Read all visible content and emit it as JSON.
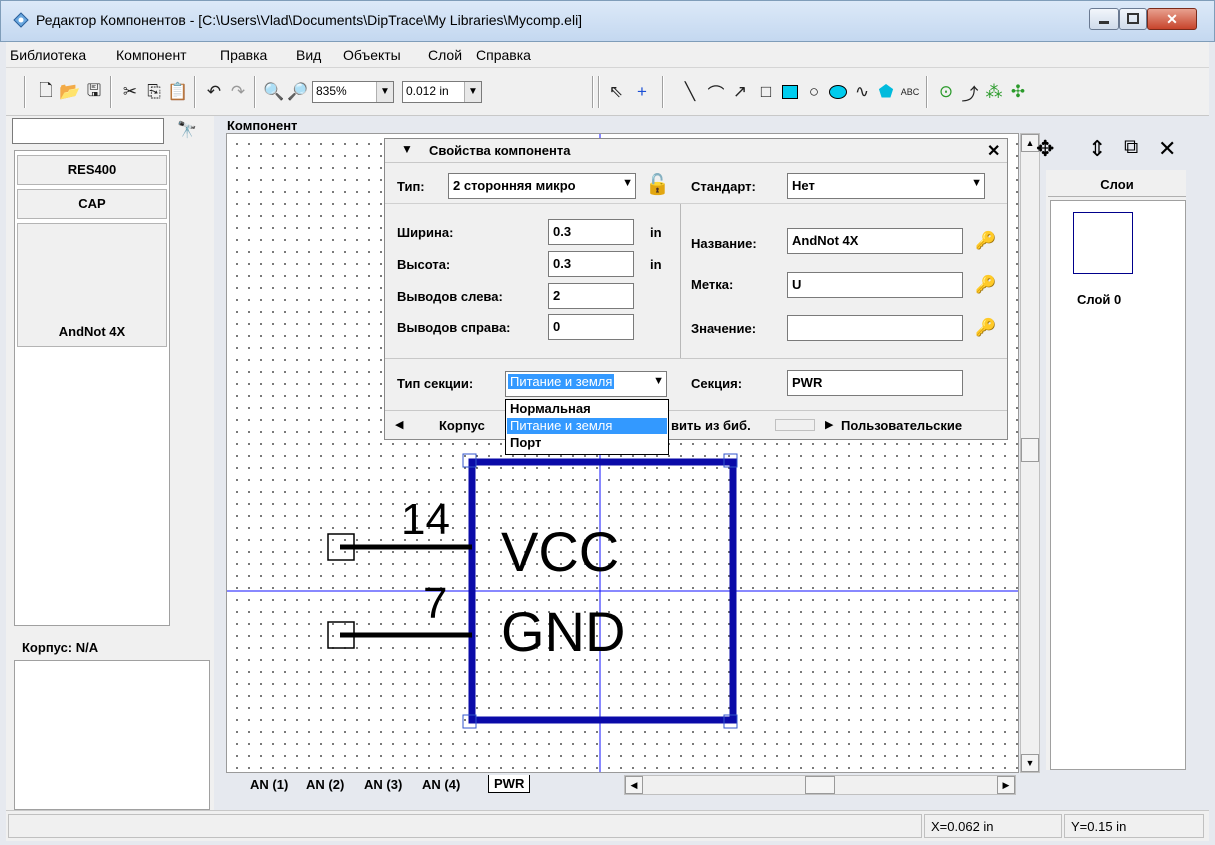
{
  "window": {
    "title": "Редактор Компонентов - [C:\\Users\\Vlad\\Documents\\DipTrace\\My Libraries\\Mycomp.eli]",
    "close_label": "✕"
  },
  "menu": [
    "Библиотека",
    "Компонент",
    "Правка",
    "Вид",
    "Объекты",
    "Слой",
    "Справка"
  ],
  "toolbar": {
    "zoom_value": "835%",
    "grid_value": "0.012 in"
  },
  "left_panel": {
    "components": [
      "RES400",
      "CAP",
      "AndNot 4X"
    ],
    "package_label": "Корпус: N/A"
  },
  "canvas": {
    "label": "Компонент",
    "pins": [
      {
        "number": "14",
        "name": "VCC"
      },
      {
        "number": "7",
        "name": "GND"
      }
    ],
    "tabs": [
      "AN (1)",
      "AN (2)",
      "AN (3)",
      "AN (4)",
      "PWR"
    ],
    "active_tab": "PWR"
  },
  "dialog": {
    "title": "Свойства компонента",
    "type_label": "Тип:",
    "type_value": "2 сторонняя микро",
    "standard_label": "Стандарт:",
    "standard_value": "Нет",
    "width_label": "Ширина:",
    "width_value": "0.3",
    "width_unit": "in",
    "height_label": "Высота:",
    "height_value": "0.3",
    "height_unit": "in",
    "pins_left_label": "Выводов слева:",
    "pins_left_value": "2",
    "pins_right_label": "Выводов справа:",
    "pins_right_value": "0",
    "name_label": "Название:",
    "name_value": "AndNot 4X",
    "ref_label": "Метка:",
    "ref_value": "U",
    "value_label": "Значение:",
    "value_value": "",
    "section_type_label": "Тип секции:",
    "section_type_value": "Питание и земля",
    "section_label": "Секция:",
    "section_value": "PWR",
    "section_options": [
      "Нормальная",
      "Питание и земля",
      "Порт"
    ],
    "selected_option": "Питание и земля",
    "bottom_left": "Корпус",
    "bottom_mid": "вить из биб.",
    "bottom_right": "Пользовательские"
  },
  "layers": {
    "header": "Слои",
    "items": [
      "Слой 0"
    ]
  },
  "status": {
    "x": "X=0.062 in",
    "y": "Y=0.15 in"
  },
  "colors": {
    "accent": "#3399ff",
    "component_body": "#0a0aa8"
  }
}
